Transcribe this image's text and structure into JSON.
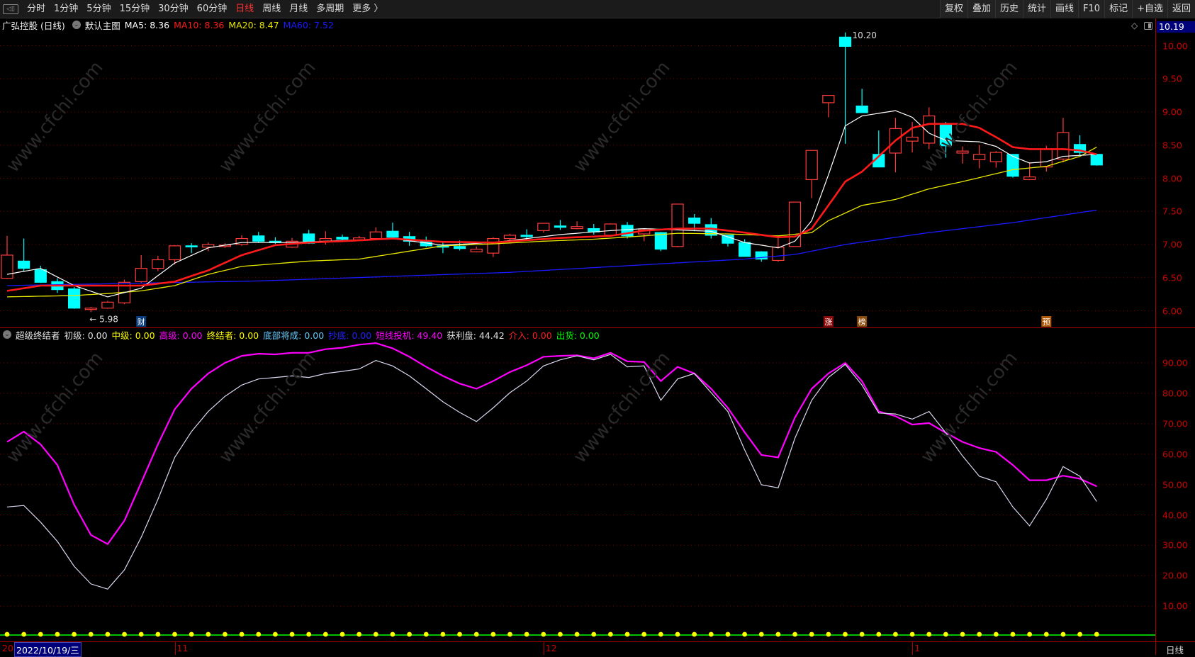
{
  "toolbar": {
    "periods": [
      "分时",
      "1分钟",
      "5分钟",
      "15分钟",
      "30分钟",
      "60分钟",
      "日线",
      "周线",
      "月线",
      "多周期",
      "更多 〉"
    ],
    "active_period": "日线",
    "actions": [
      "复权",
      "叠加",
      "历史",
      "统计",
      "画线",
      "F10",
      "标记",
      "+自选",
      "返回"
    ]
  },
  "info": {
    "stock": "广弘控股 (日线)",
    "template": "默认主图",
    "ma5": "MA5: 8.36",
    "ma10": "MA10: 8.36",
    "ma20": "MA20: 8.47",
    "ma60": "MA60: 7.52"
  },
  "colors": {
    "up": "#ff3b3b",
    "down": "#00ffff",
    "ma5": "#ffffff",
    "ma10": "#ff1a1a",
    "ma20": "#e6e600",
    "ma60": "#1a1aff",
    "grid": "#7a0000",
    "short": "#ff00ff",
    "profit": "#d8d8f0"
  },
  "price_axis": {
    "labels": [
      "10.00",
      "9.50",
      "9.00",
      "8.50",
      "8.00",
      "7.50",
      "7.00",
      "6.50",
      "6.00"
    ],
    "last_price": "10.19"
  },
  "indicator": {
    "name": "超级终结者",
    "fields": [
      {
        "text": "初级: 0.00",
        "color": "#e0e0e0"
      },
      {
        "text": "中级: 0.00",
        "color": "#ffff00"
      },
      {
        "text": "高级: 0.00",
        "color": "#ff00ff"
      },
      {
        "text": "终结者: 0.00",
        "color": "#ffff00"
      },
      {
        "text": "底部将成: 0.00",
        "color": "#66ccff"
      },
      {
        "text": "抄底: 0.00",
        "color": "#2222ff"
      },
      {
        "text": "短线投机: 49.40",
        "color": "#ff00ff"
      },
      {
        "text": "获利盘: 44.42",
        "color": "#e0e0e0"
      },
      {
        "text": "介入: 0.00",
        "color": "#ff2020"
      },
      {
        "text": "出货: 0.00",
        "color": "#00ff00"
      }
    ],
    "axis_labels": [
      "90.00",
      "80.00",
      "70.00",
      "60.00",
      "50.00",
      "40.00",
      "30.00",
      "20.00",
      "10.00"
    ]
  },
  "date_axis": {
    "start": "20",
    "selected": "2022/10/19/三",
    "months": [
      {
        "label": "11",
        "bar": 10
      },
      {
        "label": "12",
        "bar": 32
      },
      {
        "label": "1",
        "bar": 54
      }
    ],
    "period": "日线"
  },
  "watermark": "www.cfchi.com",
  "chart_data": [
    {
      "type": "candlestick",
      "title": "广弘控股 (日线)",
      "ylim": [
        6.0,
        10.0
      ],
      "ohlc": [
        [
          6.49,
          7.13,
          6.48,
          6.84
        ],
        [
          6.75,
          7.09,
          6.6,
          6.64
        ],
        [
          6.62,
          6.68,
          6.42,
          6.43
        ],
        [
          6.44,
          6.49,
          6.27,
          6.32
        ],
        [
          6.33,
          6.36,
          6.03,
          6.04
        ],
        [
          6.02,
          6.06,
          5.98,
          6.04
        ],
        [
          6.04,
          6.15,
          6.03,
          6.13
        ],
        [
          6.12,
          6.47,
          6.1,
          6.43
        ],
        [
          6.44,
          6.84,
          6.42,
          6.64
        ],
        [
          6.64,
          6.83,
          6.6,
          6.77
        ],
        [
          6.77,
          6.99,
          6.7,
          6.98
        ],
        [
          6.98,
          7.02,
          6.87,
          6.97
        ],
        [
          6.96,
          7.03,
          6.9,
          7.0
        ],
        [
          6.97,
          7.02,
          6.95,
          6.99
        ],
        [
          7.0,
          7.14,
          6.98,
          7.09
        ],
        [
          7.13,
          7.19,
          7.03,
          7.05
        ],
        [
          7.05,
          7.11,
          7.01,
          7.03
        ],
        [
          6.96,
          7.1,
          6.95,
          7.05
        ],
        [
          7.16,
          7.22,
          7.01,
          7.02
        ],
        [
          7.05,
          7.2,
          7.0,
          7.09
        ],
        [
          7.11,
          7.15,
          7.06,
          7.08
        ],
        [
          7.07,
          7.13,
          7.06,
          7.1
        ],
        [
          7.09,
          7.26,
          7.07,
          7.19
        ],
        [
          7.2,
          7.33,
          7.08,
          7.11
        ],
        [
          7.12,
          7.19,
          6.98,
          7.05
        ],
        [
          7.05,
          7.12,
          6.96,
          6.98
        ],
        [
          6.98,
          7.04,
          6.87,
          6.96
        ],
        [
          6.97,
          7.06,
          6.91,
          6.94
        ],
        [
          6.89,
          6.97,
          6.88,
          6.93
        ],
        [
          6.87,
          7.11,
          6.81,
          7.09
        ],
        [
          7.09,
          7.16,
          7.05,
          7.14
        ],
        [
          7.14,
          7.23,
          7.06,
          7.12
        ],
        [
          7.21,
          7.32,
          7.18,
          7.32
        ],
        [
          7.28,
          7.37,
          7.22,
          7.26
        ],
        [
          7.24,
          7.35,
          7.23,
          7.27
        ],
        [
          7.24,
          7.31,
          7.15,
          7.19
        ],
        [
          7.14,
          7.32,
          7.13,
          7.31
        ],
        [
          7.29,
          7.34,
          7.09,
          7.13
        ],
        [
          7.16,
          7.23,
          7.05,
          7.22
        ],
        [
          7.18,
          7.19,
          6.9,
          6.93
        ],
        [
          6.97,
          7.61,
          6.96,
          7.61
        ],
        [
          7.4,
          7.46,
          7.2,
          7.32
        ],
        [
          7.3,
          7.4,
          7.09,
          7.14
        ],
        [
          7.14,
          7.14,
          6.97,
          7.02
        ],
        [
          7.03,
          7.08,
          6.82,
          6.82
        ],
        [
          6.89,
          6.9,
          6.74,
          6.78
        ],
        [
          6.76,
          7.1,
          6.74,
          6.96
        ],
        [
          6.97,
          7.64,
          6.97,
          7.64
        ],
        [
          7.98,
          8.42,
          7.7,
          8.42
        ],
        [
          9.14,
          9.25,
          8.92,
          9.25
        ],
        [
          10.13,
          10.2,
          8.52,
          9.99
        ],
        [
          9.09,
          9.35,
          8.99,
          8.99
        ],
        [
          8.36,
          8.72,
          8.17,
          8.17
        ],
        [
          8.38,
          8.91,
          8.09,
          8.75
        ],
        [
          8.56,
          8.85,
          8.39,
          8.62
        ],
        [
          8.53,
          9.07,
          8.44,
          8.94
        ],
        [
          8.82,
          8.85,
          8.31,
          8.49
        ],
        [
          8.38,
          8.48,
          8.22,
          8.41
        ],
        [
          8.28,
          8.5,
          8.15,
          8.36
        ],
        [
          8.25,
          8.41,
          8.16,
          8.39
        ],
        [
          8.36,
          8.36,
          8.01,
          8.03
        ],
        [
          7.98,
          8.24,
          7.98,
          8.02
        ],
        [
          8.17,
          8.49,
          8.1,
          8.44
        ],
        [
          8.29,
          8.91,
          8.24,
          8.69
        ],
        [
          8.51,
          8.65,
          8.34,
          8.39
        ],
        [
          8.36,
          8.36,
          8.19,
          8.2
        ]
      ],
      "ma_anchors": {
        "ma5": [
          [
            0,
            6.55
          ],
          [
            2,
            6.64
          ],
          [
            4,
            6.38
          ],
          [
            6,
            6.21
          ],
          [
            8,
            6.34
          ],
          [
            10,
            6.72
          ],
          [
            12,
            6.95
          ],
          [
            14,
            7.03
          ],
          [
            17,
            7.03
          ],
          [
            20,
            7.06
          ],
          [
            23,
            7.09
          ],
          [
            26,
            6.99
          ],
          [
            29,
            7.03
          ],
          [
            31,
            7.09
          ],
          [
            33,
            7.15
          ],
          [
            36,
            7.21
          ],
          [
            38,
            7.24
          ],
          [
            40,
            7.22
          ],
          [
            42,
            7.2
          ],
          [
            44,
            7.03
          ],
          [
            46,
            6.95
          ],
          [
            47,
            7.05
          ],
          [
            48,
            7.36
          ],
          [
            49,
            8.05
          ],
          [
            50,
            8.79
          ],
          [
            51,
            8.94
          ],
          [
            53,
            9.02
          ],
          [
            54,
            8.92
          ],
          [
            55,
            8.68
          ],
          [
            56,
            8.57
          ],
          [
            58,
            8.55
          ],
          [
            59,
            8.48
          ],
          [
            60,
            8.33
          ],
          [
            61,
            8.23
          ],
          [
            62,
            8.25
          ],
          [
            63,
            8.33
          ],
          [
            65,
            8.36
          ]
        ],
        "ma10": [
          [
            0,
            6.3
          ],
          [
            2,
            6.38
          ],
          [
            8,
            6.38
          ],
          [
            10,
            6.44
          ],
          [
            12,
            6.61
          ],
          [
            14,
            6.84
          ],
          [
            16,
            6.99
          ],
          [
            18,
            7.03
          ],
          [
            20,
            7.05
          ],
          [
            23,
            7.09
          ],
          [
            26,
            7.04
          ],
          [
            29,
            7.03
          ],
          [
            33,
            7.1
          ],
          [
            36,
            7.13
          ],
          [
            38,
            7.21
          ],
          [
            40,
            7.24
          ],
          [
            42,
            7.24
          ],
          [
            44,
            7.18
          ],
          [
            46,
            7.11
          ],
          [
            47,
            7.12
          ],
          [
            48,
            7.24
          ],
          [
            49,
            7.59
          ],
          [
            50,
            7.95
          ],
          [
            51,
            8.1
          ],
          [
            52,
            8.33
          ],
          [
            53,
            8.57
          ],
          [
            54,
            8.76
          ],
          [
            55,
            8.82
          ],
          [
            57,
            8.82
          ],
          [
            58,
            8.76
          ],
          [
            59,
            8.62
          ],
          [
            60,
            8.47
          ],
          [
            61,
            8.44
          ],
          [
            63,
            8.44
          ],
          [
            64,
            8.42
          ],
          [
            65,
            8.36
          ]
        ],
        "ma20": [
          [
            0,
            6.21
          ],
          [
            4,
            6.23
          ],
          [
            6,
            6.26
          ],
          [
            8,
            6.3
          ],
          [
            10,
            6.38
          ],
          [
            12,
            6.55
          ],
          [
            14,
            6.67
          ],
          [
            18,
            6.75
          ],
          [
            21,
            6.78
          ],
          [
            24,
            6.9
          ],
          [
            26,
            6.98
          ],
          [
            29,
            7.01
          ],
          [
            32,
            7.05
          ],
          [
            35,
            7.08
          ],
          [
            38,
            7.13
          ],
          [
            40,
            7.17
          ],
          [
            43,
            7.16
          ],
          [
            46,
            7.13
          ],
          [
            48,
            7.18
          ],
          [
            49,
            7.36
          ],
          [
            51,
            7.59
          ],
          [
            53,
            7.68
          ],
          [
            55,
            7.84
          ],
          [
            57,
            7.95
          ],
          [
            59,
            8.07
          ],
          [
            60,
            8.13
          ],
          [
            62,
            8.18
          ],
          [
            64,
            8.33
          ],
          [
            65,
            8.47
          ]
        ],
        "ma60": [
          [
            0,
            6.38
          ],
          [
            15,
            6.45
          ],
          [
            30,
            6.58
          ],
          [
            44,
            6.78
          ],
          [
            47,
            6.85
          ],
          [
            50,
            7.0
          ],
          [
            55,
            7.18
          ],
          [
            60,
            7.33
          ],
          [
            65,
            7.52
          ]
        ]
      },
      "annotations": [
        {
          "bar": 50,
          "text": "10.20",
          "kind": "high"
        },
        {
          "bar": 5,
          "text": "← 5.98",
          "kind": "low"
        }
      ],
      "signals": [
        {
          "bar": 8,
          "text": "财",
          "color": "#0a3d7a"
        },
        {
          "bar": 49,
          "text": "涨",
          "color": "#8a0a0a"
        },
        {
          "bar": 51,
          "text": "榜",
          "color": "#8a4a0a"
        },
        {
          "bar": 62,
          "text": "预",
          "color": "#b0580a"
        }
      ]
    },
    {
      "type": "line",
      "title": "超级终结者",
      "ylim": [
        0,
        100
      ],
      "series": [
        {
          "name": "短线投机",
          "color": "#ff00ff",
          "values": [
            64,
            67.4,
            63.2,
            56.4,
            43.4,
            33.4,
            30.4,
            38.1,
            50.6,
            63.2,
            74.7,
            81.5,
            86.5,
            90,
            92.3,
            93,
            92.8,
            93.3,
            93.3,
            94.5,
            95,
            96,
            96.5,
            94.8,
            92,
            88.7,
            85.7,
            83.2,
            81.5,
            84,
            87,
            89.2,
            92,
            92.3,
            92.5,
            91.5,
            93.3,
            90.5,
            90.3,
            84,
            88.7,
            86.5,
            81.5,
            75.2,
            67.2,
            59.7,
            58.9,
            72,
            81.5,
            86.5,
            90,
            84,
            74,
            72.5,
            69.7,
            70.2,
            67,
            64,
            62,
            60.7,
            56.4,
            51.4,
            51.4,
            52.9,
            51.9,
            49.4
          ]
        },
        {
          "name": "获利盘",
          "color": "#d8d8f0",
          "values": [
            42.6,
            43.1,
            37.6,
            31.3,
            23.1,
            17.3,
            15.6,
            21.9,
            32.6,
            45.1,
            58.9,
            67.4,
            74,
            79,
            82.7,
            84.7,
            85.2,
            85.7,
            85.2,
            86.5,
            87.2,
            88,
            90.8,
            89,
            85.7,
            81.5,
            77.2,
            73.7,
            70.7,
            75.2,
            80.2,
            84,
            89,
            91,
            92.3,
            91,
            92.8,
            88.7,
            89,
            77.7,
            84.7,
            86.5,
            80.2,
            74,
            61.4,
            49.9,
            48.9,
            65.2,
            77.7,
            85.2,
            89.5,
            82.7,
            73.5,
            73.2,
            71.5,
            74,
            67,
            59.4,
            52.7,
            50.9,
            42.6,
            36.4,
            45.1,
            55.9,
            52.7,
            44.4
          ]
        }
      ],
      "baseline_dots": {
        "color": "#ffff00",
        "line_color": "#00ff00",
        "count": 66
      }
    }
  ]
}
